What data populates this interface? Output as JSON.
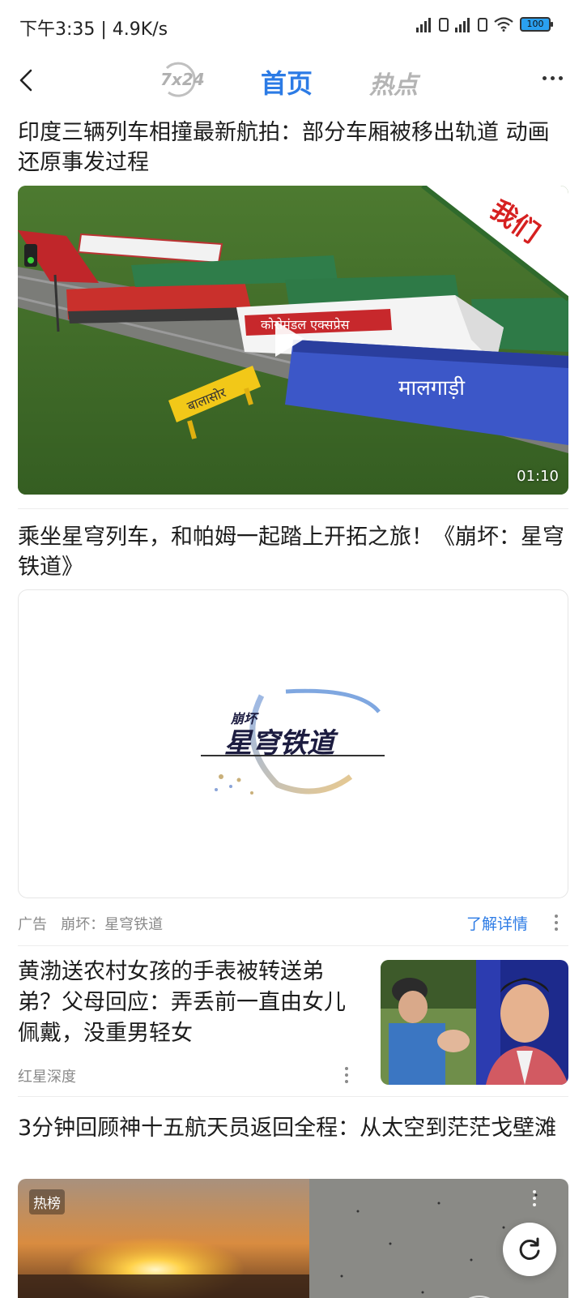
{
  "status_bar": {
    "time_speed": "下午3:35 | 4.9K/s",
    "battery": "100"
  },
  "nav": {
    "tab_7x24": "7x24",
    "tab_home": "首页",
    "tab_hot": "热点"
  },
  "feed": {
    "item1": {
      "title": "印度三辆列车相撞最新航拍：部分车厢被移出轨道 动画还原事发过程",
      "duration": "01:10",
      "watermark": "我们",
      "scene_labels": [
        "कोरोमंडल एक्सप्रेस",
        "मालगाड़ी",
        "बालासोर"
      ]
    },
    "item2": {
      "title": "乘坐星穹列车，和帕姆一起踏上开拓之旅！《崩坏：星穹铁道》",
      "ad_logo_top": "崩坏",
      "ad_logo_main": "星穹铁道",
      "ad_label": "广告",
      "advertiser": "崩坏：星穹铁道",
      "cta": "了解详情"
    },
    "item3": {
      "title": "黄渤送农村女孩的手表被转送弟弟？父母回应：弄丢前一直由女儿佩戴，没重男轻女",
      "source": "红星深度"
    },
    "item4": {
      "title": "3分钟回顾神十五航天员返回全程：从太空到茫茫戈壁滩",
      "badge": "热榜"
    }
  },
  "colors": {
    "accent": "#2c7be5",
    "meta_text": "#8a8a8a"
  }
}
